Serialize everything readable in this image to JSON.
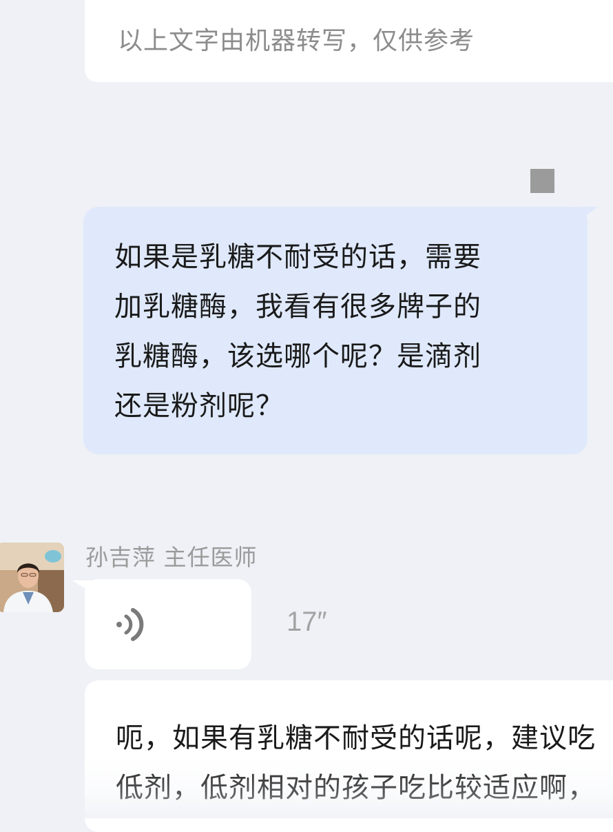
{
  "top_note": {
    "text": "以上文字由机器转写，仅供参考"
  },
  "question": {
    "line1": "如果是乳糖不耐受的话，需要",
    "line2": "加乳糖酶，我看有很多牌子的",
    "line3": "乳糖酶，该选哪个呢？是滴剂",
    "line4": "还是粉剂呢？"
  },
  "doctor": {
    "name": "孙吉萍 主任医师"
  },
  "voice_message": {
    "duration": "17″",
    "icon": "voice-wave-icon"
  },
  "transcript": {
    "line1": "呃，如果有乳糖不耐受的话呢，建议吃",
    "line2": "低剂，低剂相对的孩子吃比较适应啊，"
  },
  "colors": {
    "background": "#eff1f6",
    "question_bubble": "#dfe9fb",
    "card": "#ffffff"
  }
}
